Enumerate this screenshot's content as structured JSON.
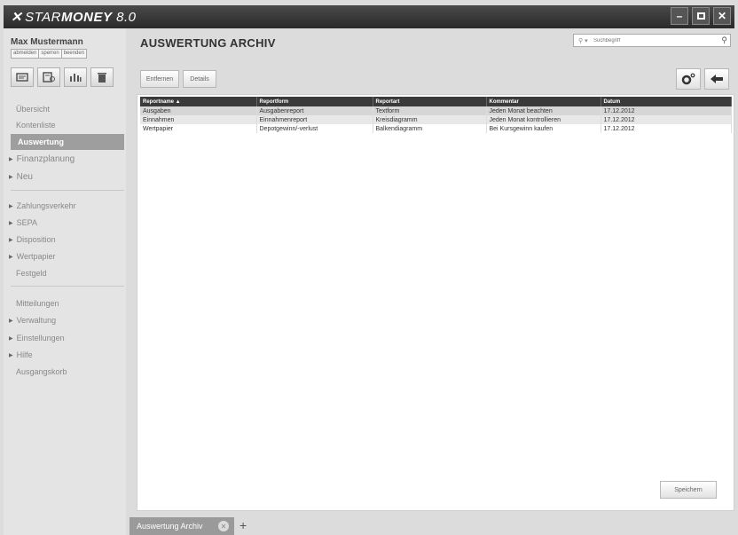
{
  "window": {
    "app_name_part1": "STAR",
    "app_name_part2": "MONEY",
    "app_version": " 8.0",
    "controls": [
      "minimize",
      "maximize",
      "close"
    ]
  },
  "user": {
    "name": "Max Mustermann",
    "links": [
      "abmelden",
      "sperren",
      "beenden"
    ]
  },
  "sidebar": {
    "tools": [
      "card-icon",
      "calculator-icon",
      "chart-icon",
      "trash-icon"
    ],
    "items": [
      {
        "label": "Übersicht"
      },
      {
        "label": "Kontenliste"
      },
      {
        "label": "Auswertung"
      },
      {
        "label": "Finanzplanung"
      },
      {
        "label": "Neu"
      },
      {
        "label": "Zahlungsverkehr"
      },
      {
        "label": "SEPA"
      },
      {
        "label": "Disposition"
      },
      {
        "label": "Wertpapier"
      },
      {
        "label": "Festgeld"
      },
      {
        "label": "Mitteilungen"
      },
      {
        "label": "Verwaltung"
      },
      {
        "label": "Einstellungen"
      },
      {
        "label": "Hilfe"
      },
      {
        "label": "Ausgangskorb"
      }
    ]
  },
  "main": {
    "title": "AUSWERTUNG ARCHIV",
    "search_placeholder": "Suchbegriff",
    "buttons": {
      "remove": "Entfernen",
      "details": "Details",
      "save": "Speichern"
    },
    "table": {
      "columns": [
        "Reportname ▲",
        "Reportform",
        "Reportart",
        "Kommentar",
        "Datum"
      ],
      "rows": [
        [
          "Ausgaben",
          "Ausgabenreport",
          "Textform",
          "Jeden Monat beachten",
          "17.12.2012"
        ],
        [
          "Einnahmen",
          "Einnahmenreport",
          "Kreisdiagramm",
          "Jeden Monat kontrollieren",
          "17.12.2012"
        ],
        [
          "Wertpapier",
          "Depotgewinn/-verlust",
          "Balkendiagramm",
          "Bei Kursgewinn kaufen",
          "17.12.2012"
        ]
      ]
    }
  },
  "tabs": [
    {
      "label": "Auswertung Archiv"
    }
  ]
}
